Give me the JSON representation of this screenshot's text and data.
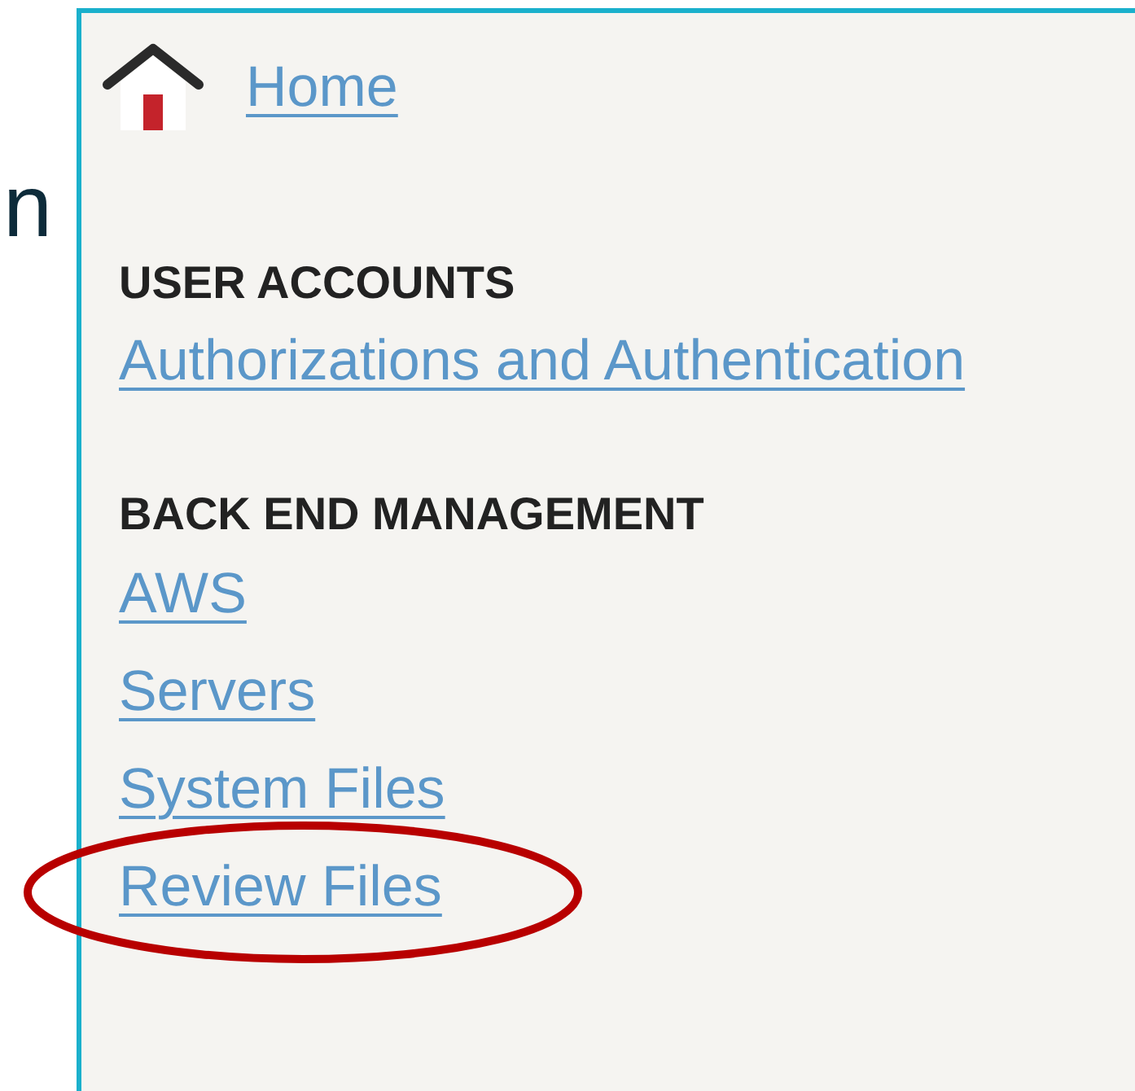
{
  "cut_text": "n",
  "home_link": "Home",
  "sections": [
    {
      "heading": "USER ACCOUNTS",
      "links": [
        {
          "label": "Authorizations and Authentication",
          "circled": false
        }
      ]
    },
    {
      "heading": "BACK END MANAGEMENT",
      "links": [
        {
          "label": "AWS",
          "circled": false
        },
        {
          "label": "Servers",
          "circled": false
        },
        {
          "label": "System Files",
          "circled": false
        },
        {
          "label": "Review Files",
          "circled": true
        }
      ]
    }
  ]
}
